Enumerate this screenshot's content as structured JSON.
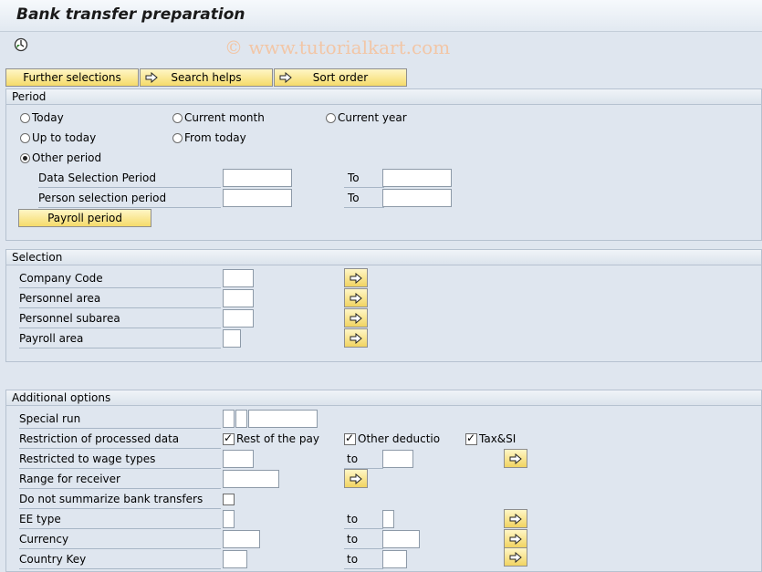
{
  "title": "Bank transfer preparation",
  "watermark": "© www.tutorialkart.com",
  "buttons": {
    "further": "Further selections",
    "search": "Search helps",
    "sort": "Sort order",
    "payroll": "Payroll period"
  },
  "period": {
    "heading": "Period",
    "radios": [
      "Today",
      "Current month",
      "Current year",
      "Up to today",
      "From today",
      "Other period"
    ],
    "data_sel_label": "Data Selection Period",
    "person_sel_label": "Person selection period",
    "to": "To"
  },
  "selection": {
    "heading": "Selection",
    "rows": [
      "Company Code",
      "Personnel area",
      "Personnel subarea",
      "Payroll area"
    ]
  },
  "additional": {
    "heading": "Additional options",
    "special_run": "Special run",
    "restriction": "Restriction of processed data",
    "cb1": "Rest of the pay",
    "cb2": "Other deductio",
    "cb3": "Tax&SI",
    "wage": "Restricted to wage types",
    "range": "Range for receiver",
    "nosum": "Do not summarize bank transfers",
    "eetype": "EE type",
    "currency": "Currency",
    "country": "Country Key",
    "to": "to"
  }
}
